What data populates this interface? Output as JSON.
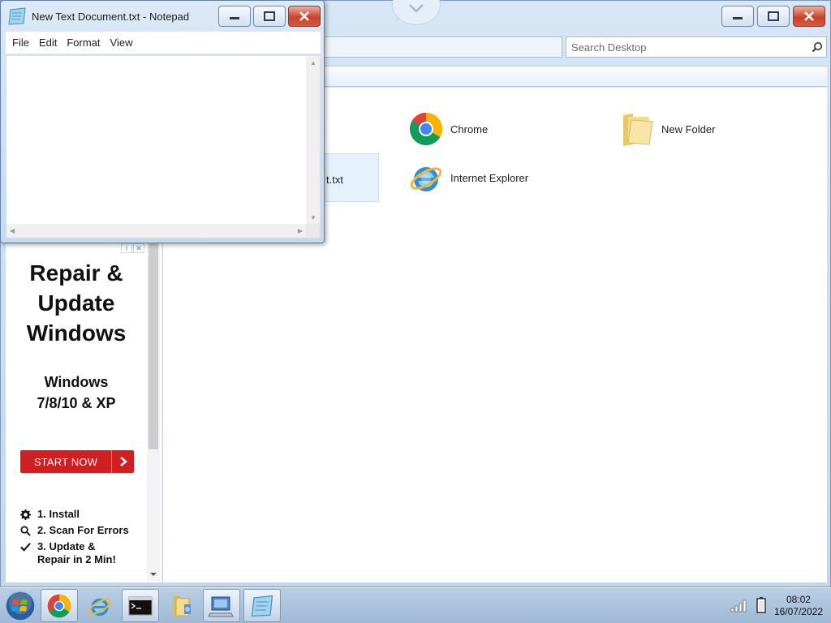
{
  "explorer": {
    "search_placeholder": "Search Desktop",
    "items": {
      "selected_partial_label": "t.txt",
      "chrome": "Chrome",
      "ie": "Internet Explorer",
      "folder": "New Folder"
    }
  },
  "notepad": {
    "title": "New Text Document.txt - Notepad",
    "menu": [
      "File",
      "Edit",
      "Format",
      "View"
    ],
    "content": ""
  },
  "ad": {
    "headline": "Repair &\nUpdate\nWindows",
    "subhead": "Windows\n7/8/10 & XP",
    "cta": "START NOW",
    "steps": [
      "1. Install",
      "2. Scan For Errors",
      "3. Update &\nRepair in 2 Min!"
    ],
    "badge_icons": [
      "info-icon",
      "close-icon"
    ]
  },
  "taskbar": {
    "apps": [
      "start-orb",
      "chrome",
      "internet-explorer",
      "command-prompt",
      "windows-explorer",
      "remote-desktop",
      "notepad"
    ],
    "time": "08:02",
    "date": "16/07/2022"
  },
  "colors": {
    "accent": "#3a78c3",
    "close_red": "#c9432d",
    "ad_button": "#d01f22"
  }
}
